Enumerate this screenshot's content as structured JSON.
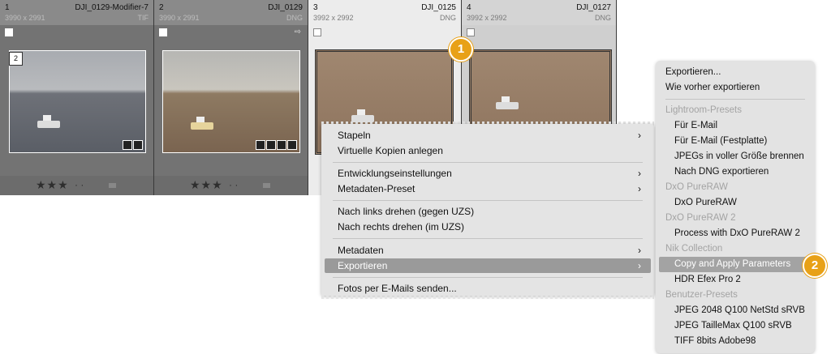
{
  "grid": {
    "cells": [
      {
        "index": "1",
        "filename": "DJI_0129-Modifier-7",
        "dims": "3990 x 2991",
        "type": "TIF",
        "badge": "2",
        "stars": "★★★",
        "dots": "· ·"
      },
      {
        "index": "2",
        "filename": "DJI_0129",
        "dims": "3990 x 2991",
        "type": "DNG",
        "stars": "★★★",
        "dots": "· ·"
      },
      {
        "index": "3",
        "filename": "DJI_0125",
        "dims": "3992 x 2992",
        "type": "DNG"
      },
      {
        "index": "4",
        "filename": "DJI_0127",
        "dims": "3992 x 2992",
        "type": "DNG"
      }
    ]
  },
  "context_menu": {
    "items": {
      "stapeln": "Stapeln",
      "virtuelle": "Virtuelle Kopien anlegen",
      "entwicklung": "Entwicklungseinstellungen",
      "metadaten_preset": "Metadaten-Preset",
      "links": "Nach links drehen (gegen UZS)",
      "rechts": "Nach rechts drehen (im UZS)",
      "metadaten": "Metadaten",
      "exportieren": "Exportieren",
      "email": "Fotos per E-Mails senden..."
    },
    "chevron": "›"
  },
  "submenu": {
    "items": [
      "Exportieren...",
      "Wie vorher exportieren",
      "Lightroom-Presets",
      "Für E-Mail",
      "Für E-Mail (Festplatte)",
      "JPEGs in voller Größe brennen",
      "Nach DNG exportieren",
      "DxO PureRAW",
      "DxO PureRAW",
      "DxO PureRAW 2",
      "Process with DxO PureRAW 2",
      "Nik Collection",
      "Copy and Apply Parameters",
      "HDR Efex Pro 2",
      "Benutzer-Presets",
      "JPEG 2048 Q100 NetStd sRVB",
      "JPEG TailleMax Q100 sRVB",
      "TIFF 8bits Adobe98"
    ]
  },
  "callouts": {
    "one": "1",
    "two": "2"
  },
  "colors": {
    "accent": "#e8a117",
    "menu_bg": "#e4e4e4",
    "highlight": "#9a9a9a"
  }
}
